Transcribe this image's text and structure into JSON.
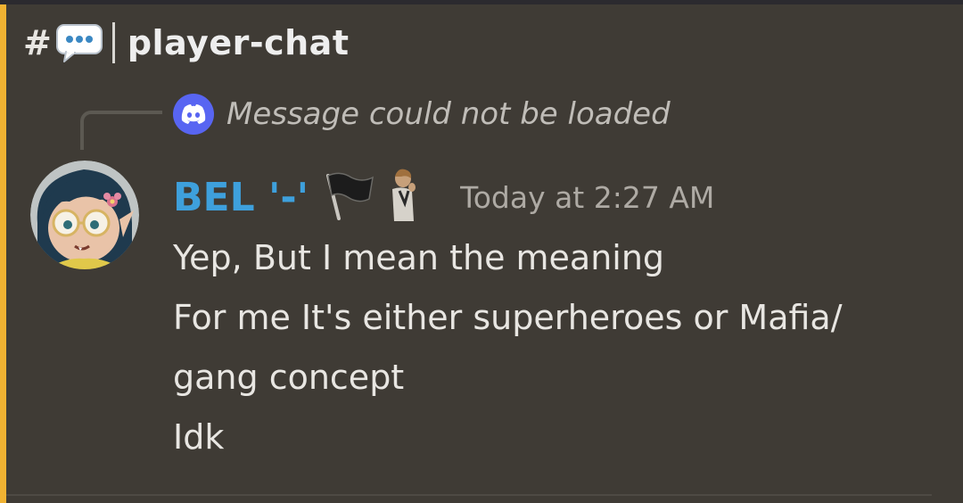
{
  "channel": {
    "hash": "#",
    "icon": "speech-bubble-icon",
    "name": "player-chat"
  },
  "reply": {
    "icon": "discord-logo-icon",
    "text": "Message could not be loaded"
  },
  "message": {
    "author": "BEL '-'",
    "badges": [
      "black-flag-icon",
      "person-sticker-icon"
    ],
    "timestamp": "Today at 2:27 AM",
    "lines": [
      "Yep, But I mean the meaning",
      "For me It's either superheroes or Mafia/",
      "gang concept",
      "Idk"
    ]
  },
  "colors": {
    "background": "#3f3b35",
    "accent_bar": "#f0b232",
    "username": "#3ea0dc",
    "discord_blurple": "#5865f2"
  }
}
